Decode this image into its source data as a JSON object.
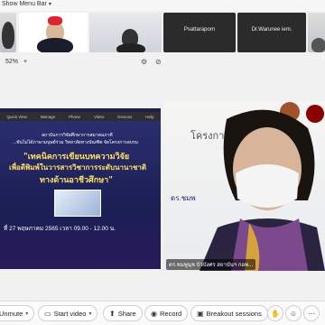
{
  "top": {
    "show_menu": "Show Menu Bar"
  },
  "thumbnails": [
    {
      "name": ""
    },
    {
      "name": ""
    },
    {
      "name": ""
    },
    {
      "name": "Psattaraporn"
    },
    {
      "name": "Dr.Warunee iem."
    },
    {
      "name": ""
    }
  ],
  "zoom": {
    "level": "52%",
    "zoom_out": "–",
    "zoom_in": "+"
  },
  "share": {
    "toolbar": [
      "Quick View",
      "Manage",
      "Phone",
      "Video",
      "Devices",
      "Help"
    ],
    "org1": "สถาบันการวิจัยศึกษาการสมาคมภาคี",
    "org2": "...ชันไม่ได้ภาษามนุษย์ร่วม วิทยาลัยทางบัณฑิต จัดโครงการอบรม",
    "title1": "\"เทคนิคการเขียนบทความวิจัย",
    "title2": "เพื่อตีพิมพ์ในวารสารวิชาการระดับนานาชาติ",
    "title3": "ทางด้านอาชีวศึกษา\"",
    "date": "ที่ 27 พฤษภาคม 2565 เวลา 09.00 - 12.00 น."
  },
  "speaker": {
    "caption": "ดร.ชมพูนุช บัวบังศร สถาบันฯ กอพ..."
  },
  "bottom": {
    "unmute": "Unmute",
    "start_video": "Start video",
    "share": "Share",
    "record": "Record",
    "breakout": "Breakout sessions"
  }
}
